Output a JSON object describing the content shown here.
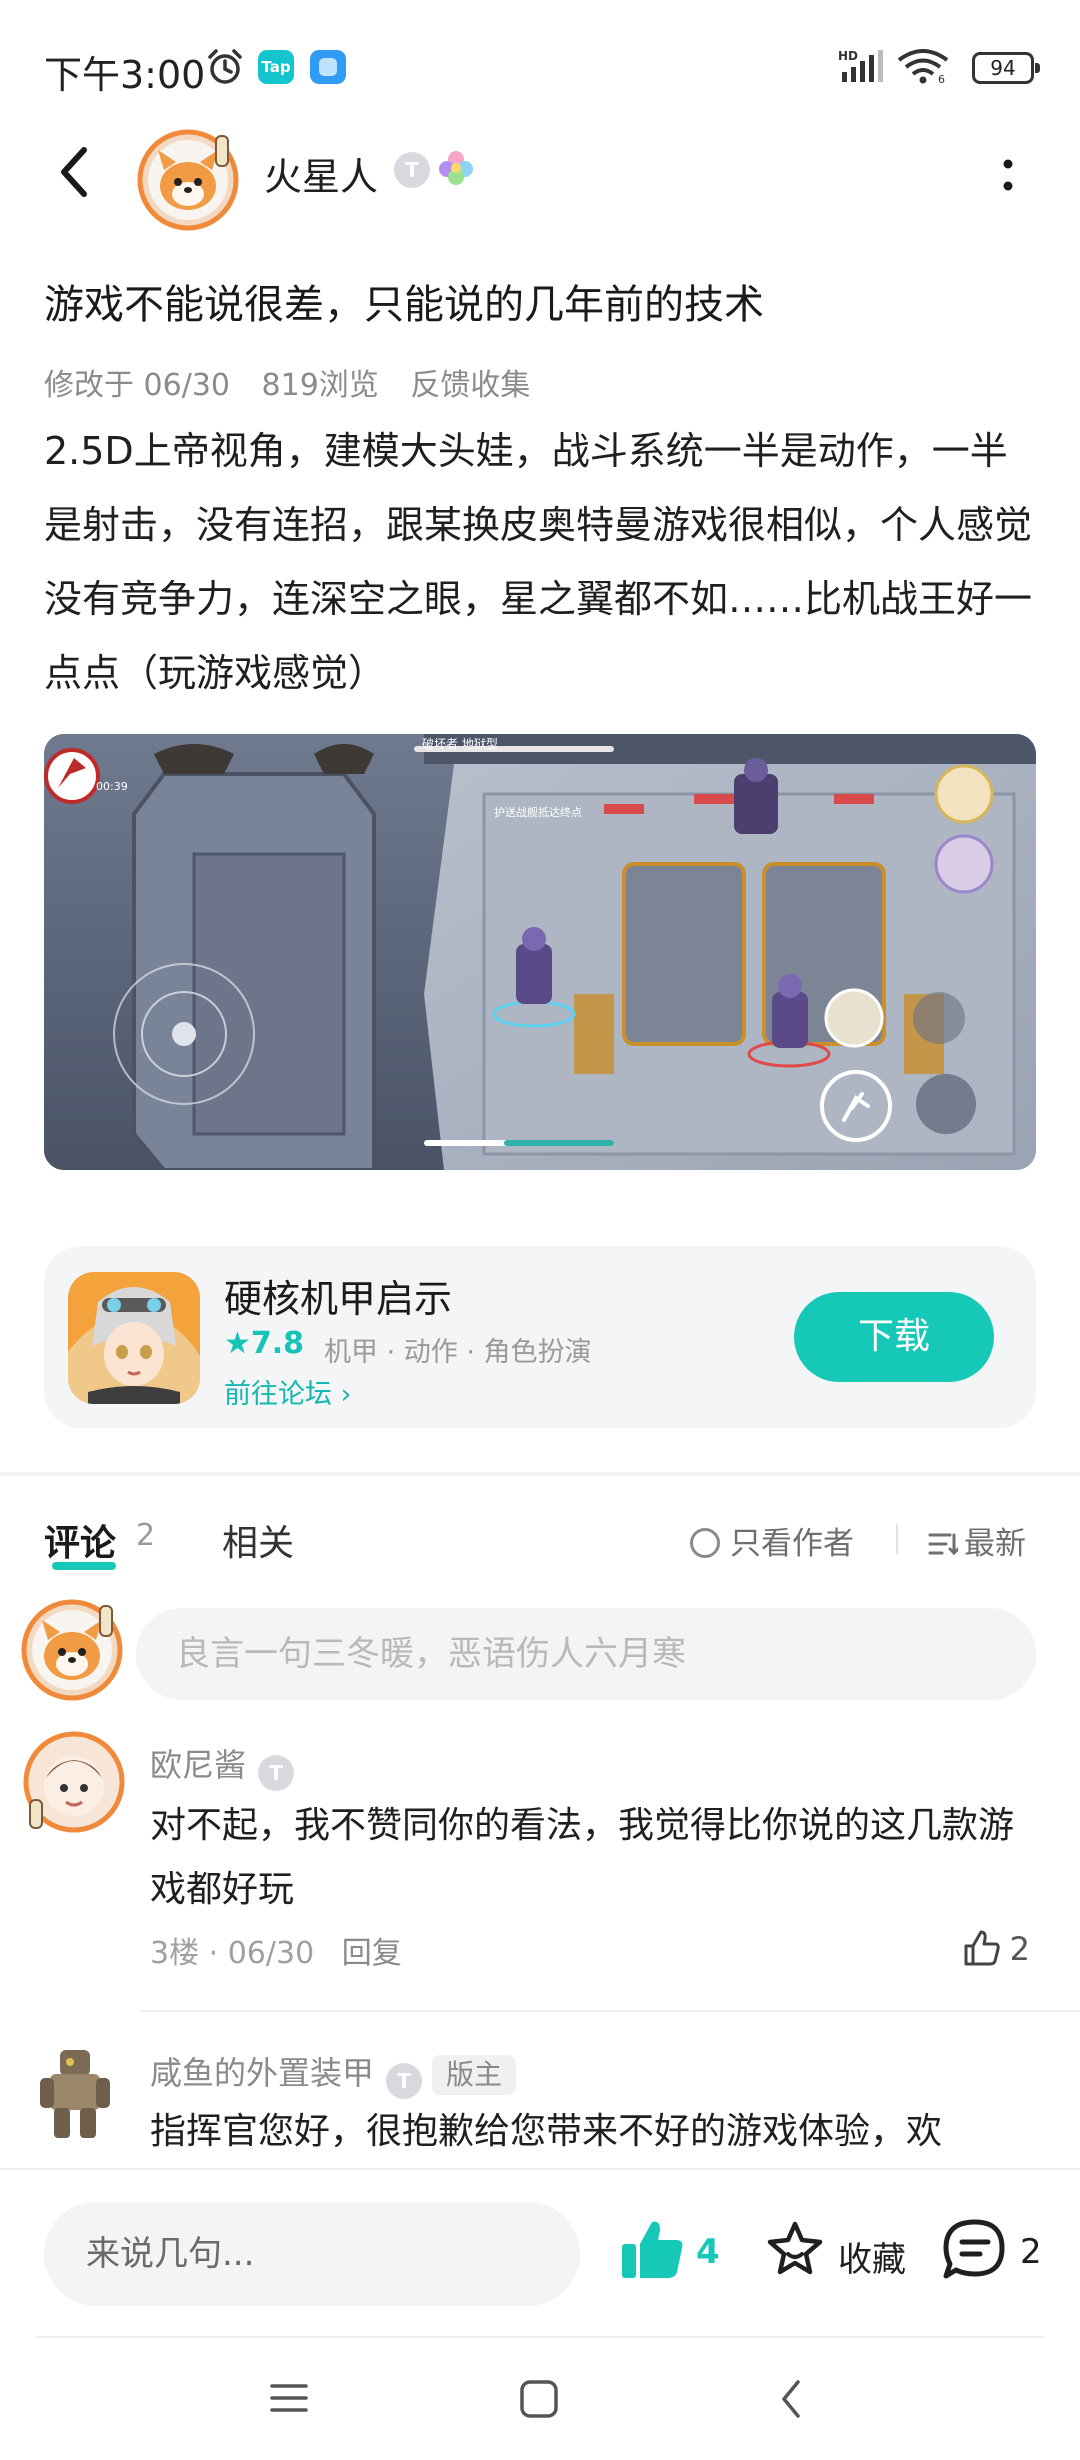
{
  "status_bar": {
    "time": "下午3:00",
    "tap_badge": "Tap",
    "battery": "94",
    "icons": [
      "alarm-icon",
      "tap-app-icon",
      "message-app-icon",
      "hd-signal-icon",
      "wifi-icon",
      "battery-icon"
    ]
  },
  "header": {
    "author_name": "火星人",
    "level_badge": "T",
    "icons": [
      "back-icon",
      "flower-icon",
      "more-icon"
    ]
  },
  "post": {
    "title": "游戏不能说很差，只能说的几年前的技术",
    "meta": {
      "modified": "修改于 06/30",
      "views": "819浏览",
      "category": "反馈收集"
    },
    "body": "2.5D上帝视角，建模大头娃，战斗系统一半是动作，一半是射击，没有连招，跟某换皮奥特曼游戏很相似，个人感觉没有竞争力，连深空之眼，星之翼都不如……比机战王好一点点（玩游戏感觉）",
    "image_overlay": {
      "timer": "00:39",
      "objective": "破坏者 地狱型",
      "hint": "护送战舰抵达终点"
    }
  },
  "game_card": {
    "name": "硬核机甲启示",
    "rating": "7.8",
    "tags": "机甲 · 动作 · 角色扮演",
    "forum_link": "前往论坛",
    "download_label": "下载"
  },
  "tabs": {
    "comments_label": "评论",
    "comments_count": "2",
    "related_label": "相关",
    "author_only_label": "只看作者",
    "sort_label": "最新"
  },
  "comment_input": {
    "placeholder": "良言一句三冬暖，恶语伤人六月寒"
  },
  "comments": [
    {
      "author": "欧尼酱",
      "badge": "T",
      "text": "对不起，我不赞同你的看法，我觉得比你说的这几款游戏都好玩",
      "floor_date": "3楼 · 06/30",
      "reply_label": "回复",
      "likes": "2"
    },
    {
      "author": "咸鱼的外置装甲",
      "badge": "T",
      "mod_label": "版主",
      "text": "指挥官您好，很抱歉给您带来不好的游戏体验，欢"
    }
  ],
  "bottom_bar": {
    "reply_placeholder": "来说几句...",
    "like_count": "4",
    "favorite_label": "收藏",
    "comment_count": "2"
  },
  "colors": {
    "accent": "#15c8b7",
    "text_primary": "#1f1f1f",
    "text_secondary": "#8b8b8b",
    "card_bg": "#f4f5f7"
  }
}
